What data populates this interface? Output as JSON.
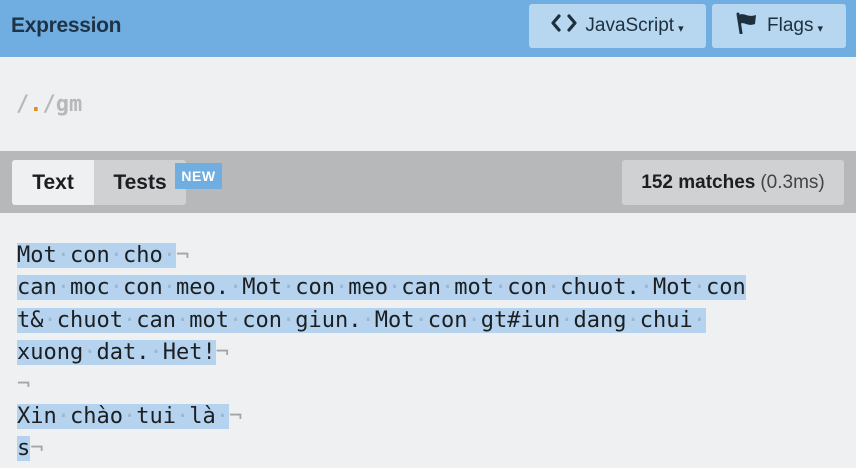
{
  "header": {
    "title": "Expression",
    "language_label": "JavaScript",
    "flags_label": "Flags",
    "caret": "▾"
  },
  "expression": {
    "open": "/",
    "pattern": ".",
    "close": "/",
    "flags": "gm"
  },
  "tabs": {
    "text_label": "Text",
    "tests_label": "Tests",
    "new_badge": "NEW"
  },
  "results": {
    "match_count": "152 matches",
    "time": "(0.3ms)"
  },
  "test_text": {
    "lines": [
      "Mot con cho ",
      "can moc con meo. Mot con meo can mot con chuot. Mot con",
      "t& chuot can mot con giun. Mot con gt#iun dang chui ",
      "xuong dat. Het!",
      "",
      "Xin chào tui là ",
      "s"
    ],
    "line_end_marks": [
      true,
      false,
      false,
      true,
      true,
      true,
      true
    ]
  },
  "icons": {
    "language": "code-brackets-icon",
    "flags": "flag-icon"
  },
  "colors": {
    "header_bg": "#70ade1",
    "match_highlight": "#b5d3ee",
    "accent_dot": "#e58a1c"
  }
}
